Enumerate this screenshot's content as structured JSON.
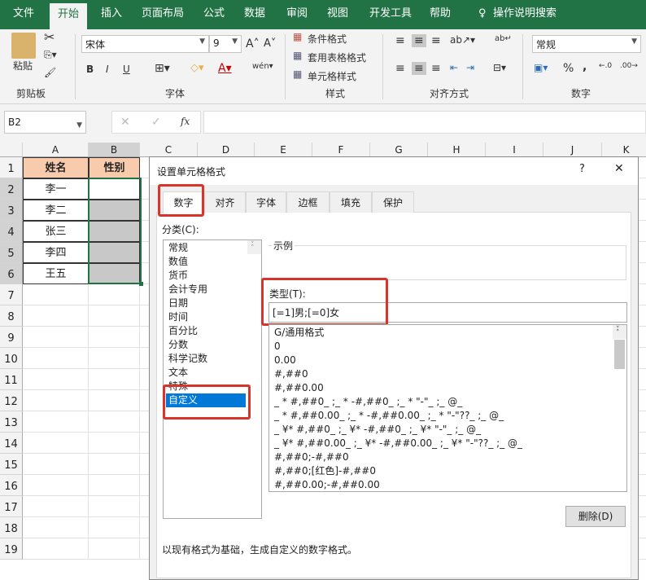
{
  "tabs": [
    "文件",
    "开始",
    "插入",
    "页面布局",
    "公式",
    "数据",
    "审阅",
    "视图",
    "开发工具",
    "帮助",
    "操作说明搜索"
  ],
  "ribbon": {
    "paste": "粘贴",
    "font_name": "宋体",
    "font_size": "9",
    "cond_format": "条件格式",
    "table_format": "套用表格格式",
    "cell_style": "单元格样式",
    "number_format": "常规",
    "groups": [
      "剪贴板",
      "字体",
      "样式",
      "对齐方式",
      "数字"
    ],
    "bold": "B",
    "italic": "I",
    "underline": "U",
    "percent": "%",
    "comma": ","
  },
  "formula_bar": {
    "name_box": "B2",
    "fx": "fx",
    "value": ""
  },
  "columns": [
    "A",
    "B",
    "C",
    "D",
    "E",
    "F",
    "G",
    "H",
    "I",
    "J",
    "K"
  ],
  "rows": [
    "1",
    "2",
    "3",
    "4",
    "5",
    "6",
    "7",
    "8",
    "9",
    "10",
    "11",
    "12",
    "13",
    "14",
    "15",
    "16",
    "17",
    "18",
    "19"
  ],
  "sheet": {
    "headers": [
      "姓名",
      "性别"
    ],
    "names": [
      "李一",
      "李二",
      "张三",
      "李四",
      "王五"
    ]
  },
  "dialog": {
    "title": "设置单元格格式",
    "help": "?",
    "close": "✕",
    "tabs": [
      "数字",
      "对齐",
      "字体",
      "边框",
      "填充",
      "保护"
    ],
    "category_label": "分类(C):",
    "categories": [
      "常规",
      "数值",
      "货币",
      "会计专用",
      "日期",
      "时间",
      "百分比",
      "分数",
      "科学记数",
      "文本",
      "特殊",
      "自定义"
    ],
    "sample_label": "示例",
    "type_label": "类型(T):",
    "type_value": "[=1]男;[=0]女",
    "formats": [
      "G/通用格式",
      "0",
      "0.00",
      "#,##0",
      "#,##0.00",
      "_ * #,##0_ ;_ * -#,##0_ ;_ * \"-\"_ ;_ @_",
      "_ * #,##0.00_ ;_ * -#,##0.00_ ;_ * \"-\"??_ ;_ @_",
      "_ ¥* #,##0_ ;_ ¥* -#,##0_ ;_ ¥* \"-\"_ ;_ @_",
      "_ ¥* #,##0.00_ ;_ ¥* -#,##0.00_ ;_ ¥* \"-\"??_ ;_ @_",
      "#,##0;-#,##0",
      "#,##0;[红色]-#,##0",
      "#,##0.00;-#,##0.00"
    ],
    "delete": "删除(D)",
    "description": "以现有格式为基础，生成自定义的数字格式。"
  }
}
